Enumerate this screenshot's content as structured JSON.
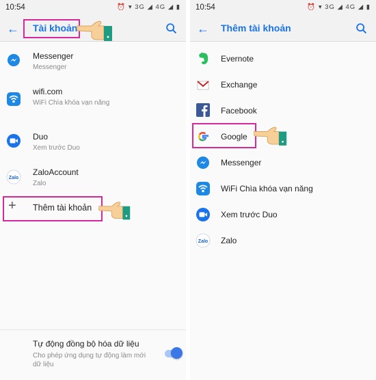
{
  "left": {
    "status_time": "10:54",
    "status_icons": "⏰ ▾ 3G ◢ 4G ◢ ▮",
    "title": "Tài khoản",
    "accounts": [
      {
        "name": "Messenger",
        "sub": "Messenger",
        "icon": "messenger-icon"
      },
      {
        "name": "wifi.com",
        "sub": "WiFi Chìa khóa vạn năng",
        "icon": "wifi-key-icon"
      },
      {
        "name": "Duo",
        "sub": "Xem trước Duo",
        "icon": "duo-icon"
      },
      {
        "name": "ZaloAccount",
        "sub": "Zalo",
        "icon": "zalo-icon"
      }
    ],
    "add_account": "Thêm tài khoản",
    "sync_title": "Tự động đồng bộ hóa dữ liệu",
    "sync_sub": "Cho phép ứng dụng tự động làm mới dữ liệu",
    "sync_enabled": true
  },
  "right": {
    "status_time": "10:54",
    "status_icons": "⏰ ▾ 3G ◢ 4G ◢ ▮",
    "title": "Thêm tài khoản",
    "providers": [
      {
        "name": "Evernote",
        "icon": "evernote-icon"
      },
      {
        "name": "Exchange",
        "icon": "exchange-mail-icon"
      },
      {
        "name": "Facebook",
        "icon": "facebook-icon"
      },
      {
        "name": "Google",
        "icon": "google-icon"
      },
      {
        "name": "Messenger",
        "icon": "messenger-icon"
      },
      {
        "name": "WiFi Chìa khóa vạn năng",
        "icon": "wifi-key-icon"
      },
      {
        "name": "Xem trước Duo",
        "icon": "duo-icon"
      },
      {
        "name": "Zalo",
        "icon": "zalo-icon"
      }
    ]
  },
  "colors": {
    "accent": "#1a73e8",
    "highlight": "#d6279b",
    "messenger": "#1e88e5",
    "duo": "#1a73e8",
    "evernote": "#2dbe60",
    "facebook": "#3b5998",
    "exchange": "#c62828"
  }
}
